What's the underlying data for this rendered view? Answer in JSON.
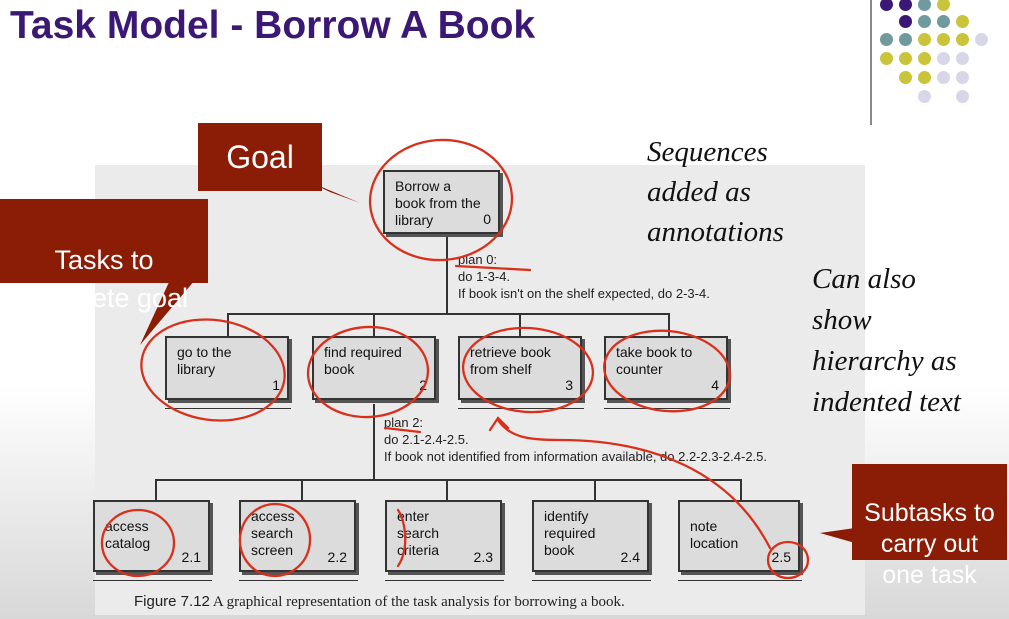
{
  "title": "Task Model - Borrow A Book",
  "callouts": {
    "goal": "Goal",
    "tasks": "Tasks to\ncomplete goal",
    "subtasks": "Subtasks to\ncarry out\none task"
  },
  "notes": {
    "sequences": "Sequences\nadded as\nannotations",
    "hierarchy": "Can also\nshow\nhierarchy as\nindented text"
  },
  "diagram": {
    "root": {
      "label": "Borrow a\nbook from the\nlibrary",
      "num": "0"
    },
    "plan0": "plan 0:\ndo 1-3-4.\nIf book isn't on the shelf expected, do 2-3-4.",
    "tasks": [
      {
        "label": "go to the\nlibrary",
        "num": "1"
      },
      {
        "label": "find required\nbook",
        "num": "2"
      },
      {
        "label": "retrieve book\nfrom shelf",
        "num": "3"
      },
      {
        "label": "take book to\ncounter",
        "num": "4"
      }
    ],
    "plan2": "plan 2:\ndo 2.1-2.4-2.5.\nIf book not identified from information available, do 2.2-2.3-2.4-2.5.",
    "subtasks": [
      {
        "label": "access\ncatalog",
        "num": "2.1"
      },
      {
        "label": "access\nsearch\nscreen",
        "num": "2.2"
      },
      {
        "label": "enter\nsearch\ncriteria",
        "num": "2.3"
      },
      {
        "label": "identify\nrequired\nbook",
        "num": "2.4"
      },
      {
        "label": "note\nlocation",
        "num": "2.5"
      }
    ],
    "caption_label": "Figure 7.12",
    "caption_text": "A graphical representation of the task analysis for borrowing a book."
  },
  "colors": {
    "title": "#3b1874",
    "callout": "#8b1d07",
    "annotation_pen": "#d9301c",
    "dots": [
      "#3b1874",
      "#6f9a9e",
      "#c9c43a",
      "#d7d7e8"
    ]
  }
}
